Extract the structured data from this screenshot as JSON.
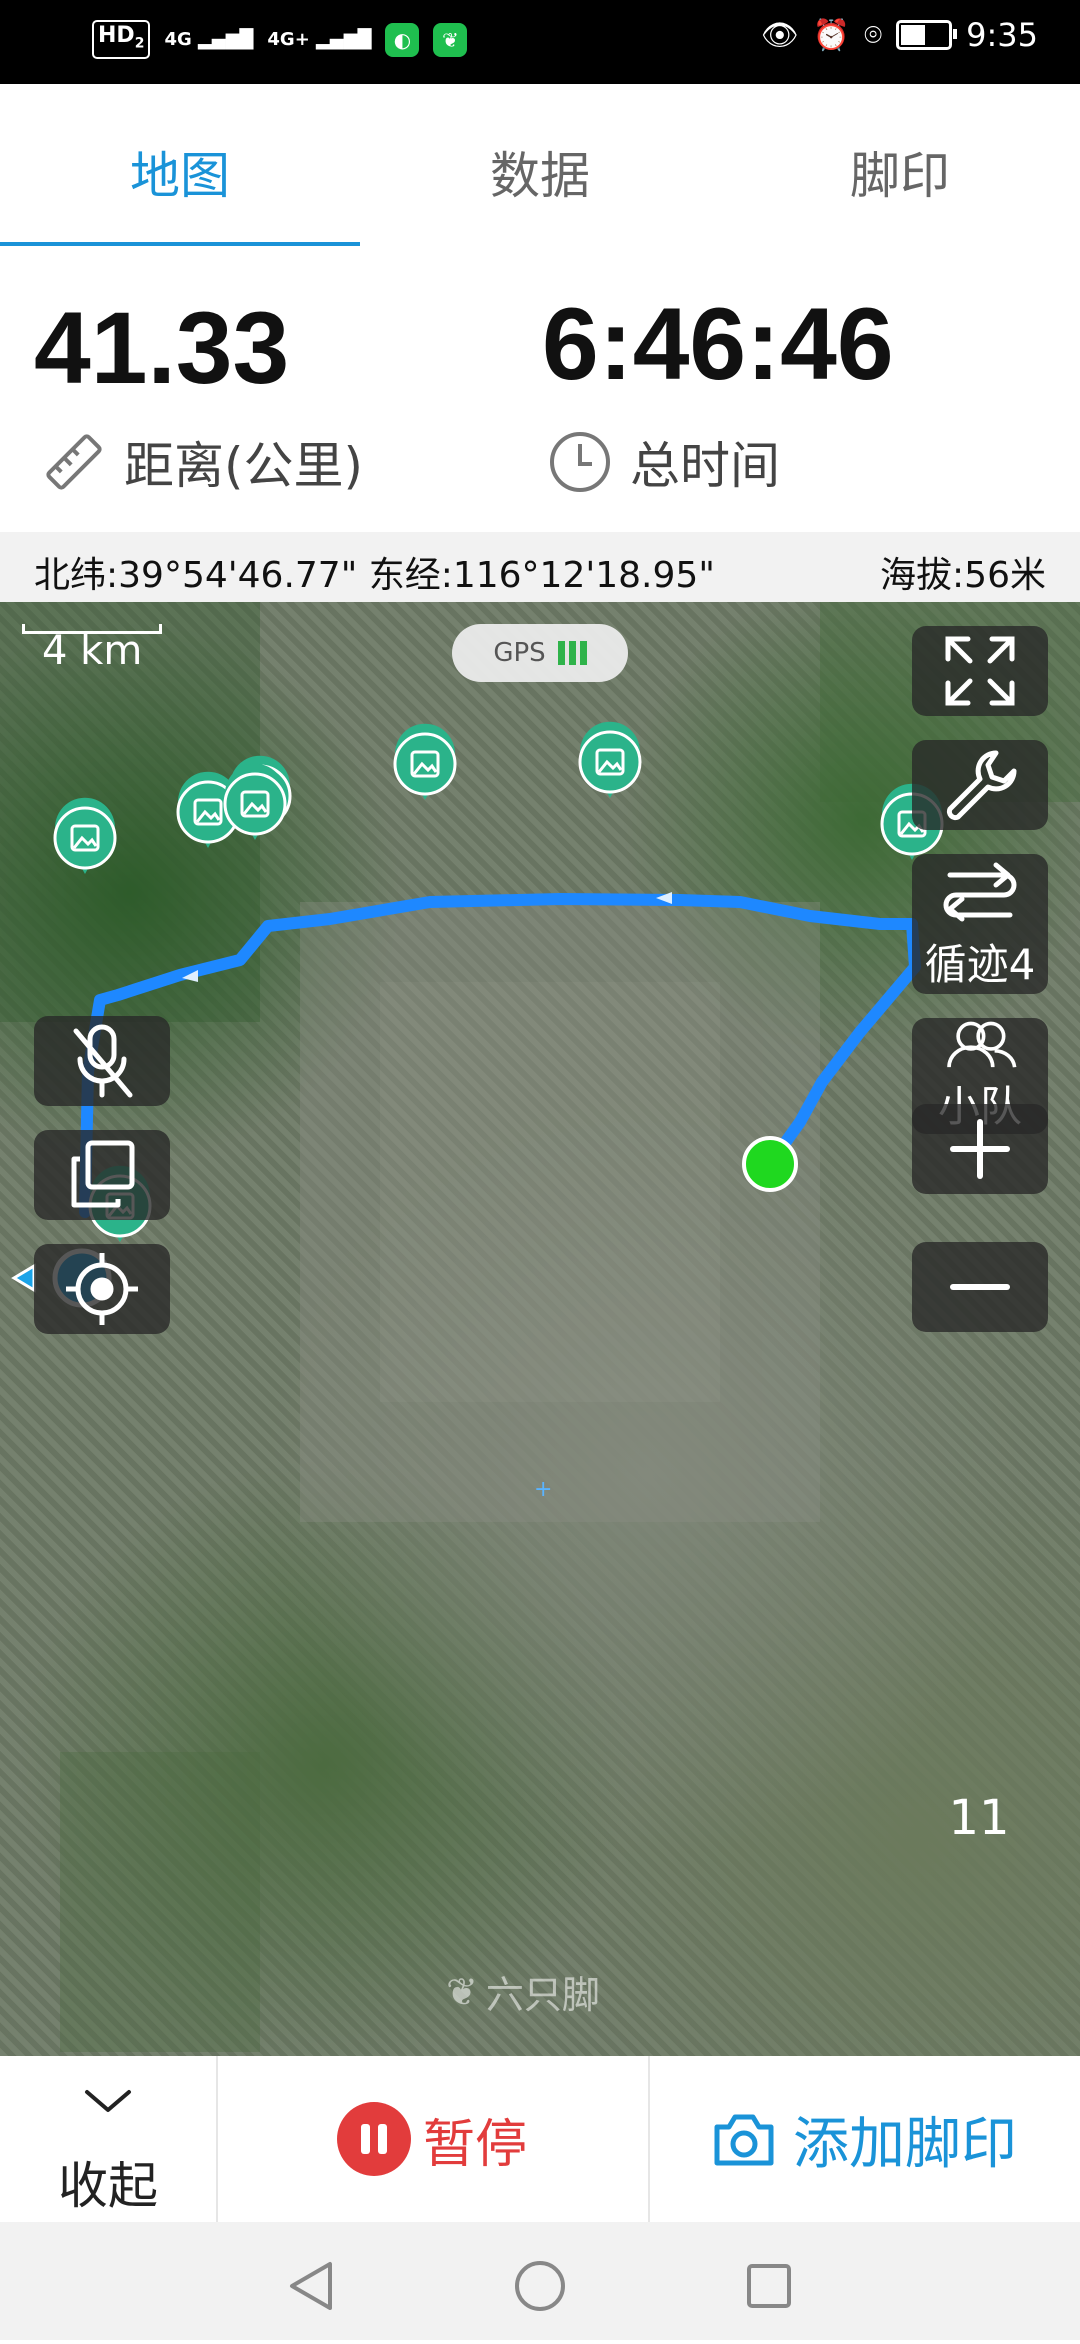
{
  "status_bar": {
    "hd": "HD",
    "sim_sub": "2",
    "net1": "4G",
    "net2": "4G+",
    "time": "9:35",
    "battery_level": 0.6
  },
  "tabs": [
    {
      "label": "地图",
      "active": true
    },
    {
      "label": "数据",
      "active": false
    },
    {
      "label": "脚印",
      "active": false
    }
  ],
  "stats": {
    "distance_value": "41.33",
    "distance_label": "距离(公里)",
    "time_value": "6:46:46",
    "time_label": "总时间"
  },
  "coords": {
    "latlon": "北纬:39°54'46.77\" 东经:116°12'18.95\"",
    "altitude": "海拔:56米"
  },
  "map": {
    "scale_label": "4 km",
    "gps_label": "GPS",
    "track_button_label": "循迹4",
    "team_button_label": "小队",
    "zoom_level": "11",
    "watermark": "六只脚",
    "colors": {
      "track": "#1e88ff",
      "start_marker": "#1fd81f",
      "current_position": "#1aa3e8",
      "photo_pin": "#2bb38a"
    }
  },
  "bottom_bar": {
    "collapse_label": "收起",
    "pause_label": "暂停",
    "add_footprint_label": "添加脚印"
  }
}
